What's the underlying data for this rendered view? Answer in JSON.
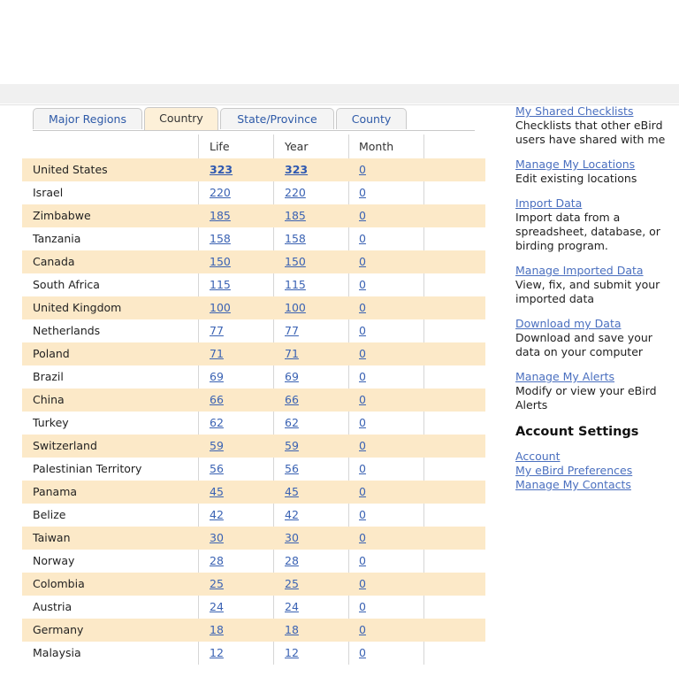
{
  "tabs": [
    {
      "label": "Major Regions",
      "active": false
    },
    {
      "label": "Country",
      "active": true
    },
    {
      "label": "State/Province",
      "active": false
    },
    {
      "label": "County",
      "active": false
    }
  ],
  "table": {
    "headers": {
      "life": "Life",
      "year": "Year",
      "month": "Month"
    },
    "rows": [
      {
        "country": "United States",
        "life": "323",
        "year": "323",
        "month": "0"
      },
      {
        "country": "Israel",
        "life": "220",
        "year": "220",
        "month": "0"
      },
      {
        "country": "Zimbabwe",
        "life": "185",
        "year": "185",
        "month": "0"
      },
      {
        "country": "Tanzania",
        "life": "158",
        "year": "158",
        "month": "0"
      },
      {
        "country": "Canada",
        "life": "150",
        "year": "150",
        "month": "0"
      },
      {
        "country": "South Africa",
        "life": "115",
        "year": "115",
        "month": "0"
      },
      {
        "country": "United Kingdom",
        "life": "100",
        "year": "100",
        "month": "0"
      },
      {
        "country": "Netherlands",
        "life": "77",
        "year": "77",
        "month": "0"
      },
      {
        "country": "Poland",
        "life": "71",
        "year": "71",
        "month": "0"
      },
      {
        "country": "Brazil",
        "life": "69",
        "year": "69",
        "month": "0"
      },
      {
        "country": "China",
        "life": "66",
        "year": "66",
        "month": "0"
      },
      {
        "country": "Turkey",
        "life": "62",
        "year": "62",
        "month": "0"
      },
      {
        "country": "Switzerland",
        "life": "59",
        "year": "59",
        "month": "0"
      },
      {
        "country": "Palestinian Territory",
        "life": "56",
        "year": "56",
        "month": "0"
      },
      {
        "country": "Panama",
        "life": "45",
        "year": "45",
        "month": "0"
      },
      {
        "country": "Belize",
        "life": "42",
        "year": "42",
        "month": "0"
      },
      {
        "country": "Taiwan",
        "life": "30",
        "year": "30",
        "month": "0"
      },
      {
        "country": "Norway",
        "life": "28",
        "year": "28",
        "month": "0"
      },
      {
        "country": "Colombia",
        "life": "25",
        "year": "25",
        "month": "0"
      },
      {
        "country": "Austria",
        "life": "24",
        "year": "24",
        "month": "0"
      },
      {
        "country": "Germany",
        "life": "18",
        "year": "18",
        "month": "0"
      },
      {
        "country": "Malaysia",
        "life": "12",
        "year": "12",
        "month": "0"
      }
    ]
  },
  "sidebar": {
    "links": [
      {
        "label": "My Shared Checklists",
        "desc": "Checklists that other eBird users have shared with me"
      },
      {
        "label": "Manage My Locations",
        "desc": "Edit existing locations"
      },
      {
        "label": "Import Data",
        "desc": "Import data from a spreadsheet, database, or birding program."
      },
      {
        "label": "Manage Imported Data",
        "desc": "View, fix, and submit your imported data"
      },
      {
        "label": "Download my Data",
        "desc": "Download and save your data on your computer"
      },
      {
        "label": "Manage My Alerts",
        "desc": "Modify or view your eBird Alerts"
      }
    ],
    "account_heading": "Account Settings",
    "account_links": [
      "Account",
      "My eBird Preferences",
      "Manage My Contacts"
    ]
  }
}
